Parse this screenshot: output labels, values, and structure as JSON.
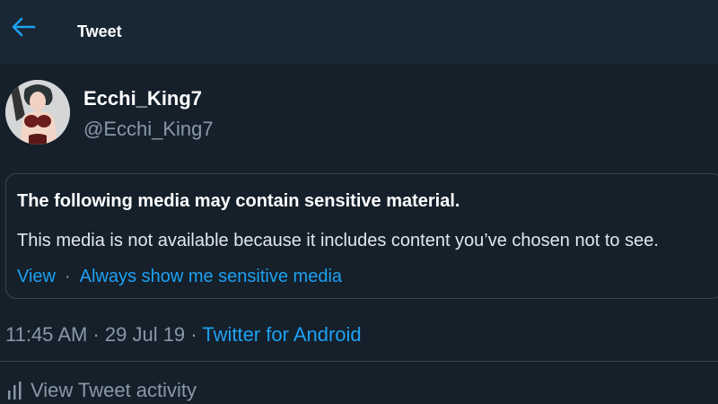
{
  "header": {
    "title": "Tweet",
    "back_icon": "arrow-left-icon"
  },
  "author": {
    "display_name": "Ecchi_King7",
    "handle": "@Ecchi_King7"
  },
  "sensitive_notice": {
    "title": "The following media may contain sensitive material.",
    "body": "This media is not available because it includes content you’ve chosen not to see.",
    "view_label": "View",
    "separator": "·",
    "always_show_label": "Always show me sensitive media"
  },
  "meta": {
    "timestamp": "11:45 AM · 29 Jul 19",
    "separator": "·",
    "source": "Twitter for Android"
  },
  "activity": {
    "label": "View Tweet activity",
    "icon": "bar-chart-icon"
  },
  "colors": {
    "background": "#15202b",
    "header": "#192734",
    "accent": "#1da1f2",
    "secondary_text": "#8899a6",
    "border": "#38444d"
  }
}
